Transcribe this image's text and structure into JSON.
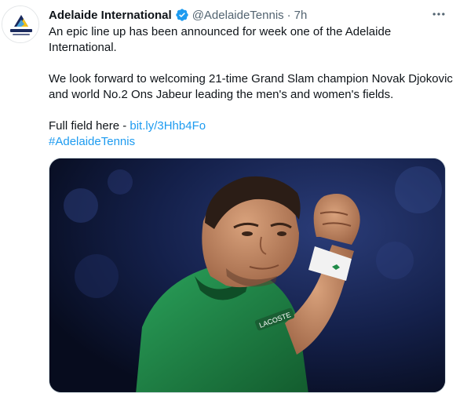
{
  "account": {
    "display_name": "Adelaide International",
    "handle": "@AdelaideTennis",
    "separator": "·",
    "timestamp": "7h",
    "verified": true,
    "avatar_icon": "adelaide-international-logo"
  },
  "tweet": {
    "line1": "An epic line up has been announced for week one of the Adelaide International.",
    "line2": "We look forward to welcoming 21-time Grand Slam champion Novak Djokovic and world No.2 Ons Jabeur leading the men's and women's fields.",
    "field_prefix": "Full field here - ",
    "link": "bit.ly/3Hhb4Fo",
    "hashtag": "#AdelaideTennis"
  },
  "media": {
    "icon": "tennis-player-photo",
    "shirt_brand": "LACOSTE"
  },
  "colors": {
    "text": "#0f1419",
    "secondary": "#536471",
    "link": "#1d9bf0",
    "verified": "#1d9bf0",
    "brand_navy": "#1a2a5e",
    "brand_yellow": "#f4c21b",
    "shirt_green": "#1f8a47"
  }
}
